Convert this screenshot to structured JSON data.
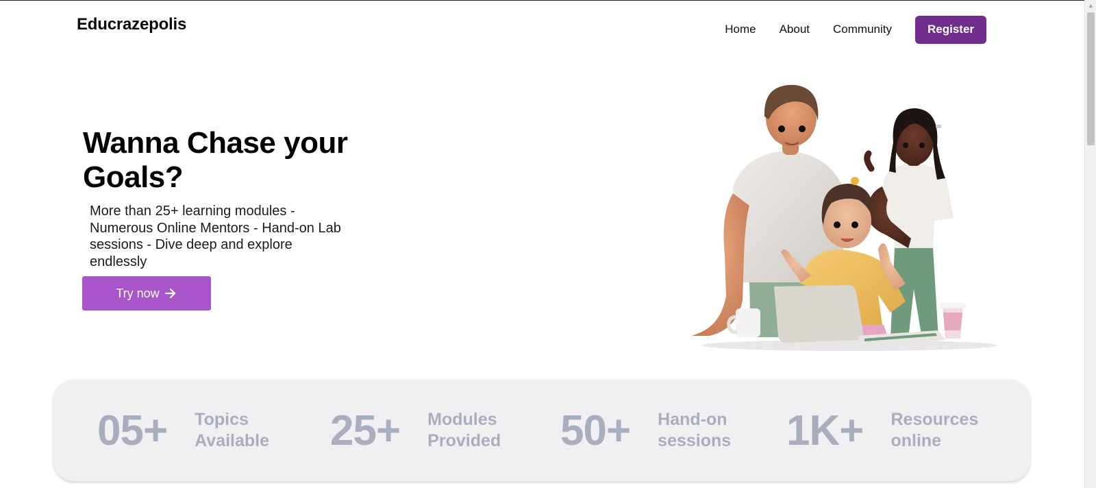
{
  "header": {
    "logo": "Educrazepolis",
    "nav": [
      "Home",
      "About",
      "Community"
    ],
    "register_label": "Register"
  },
  "hero": {
    "title": "Wanna Chase your Goals?",
    "description": "More than 25+ learning modules - Numerous Online Mentors - Hand-on Lab sessions - Dive deep and explore endlessly",
    "cta_label": "Try now",
    "cta_icon": "arrow-right-icon",
    "illustration": "three-people-laptop-illustration"
  },
  "stats": [
    {
      "value": "05+",
      "label": "Topics Available"
    },
    {
      "value": "25+",
      "label": "Modules Provided"
    },
    {
      "value": "50+",
      "label": "Hand-on sessions"
    },
    {
      "value": "1K+",
      "label": "Resources online"
    }
  ],
  "colors": {
    "register_bg": "#6f2e8c",
    "cta_bg": "#a855c9",
    "stats_text": "#a9aebf",
    "stats_bg": "#f0f0f2"
  }
}
